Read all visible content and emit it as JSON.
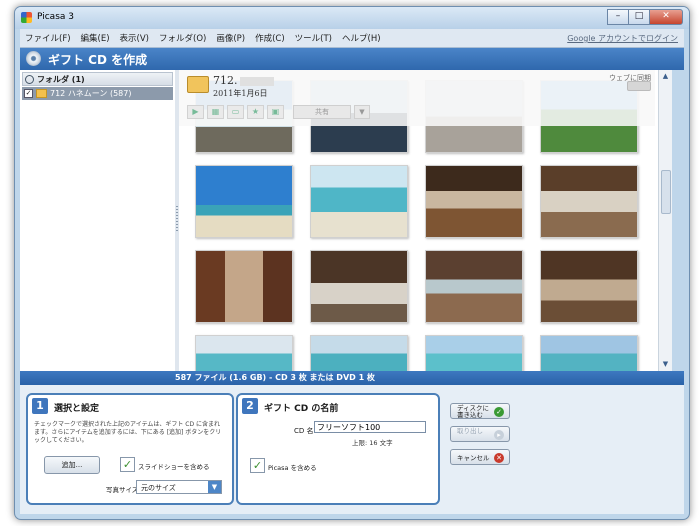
{
  "window": {
    "title": "Picasa 3"
  },
  "menu": {
    "items": [
      "ファイル(F)",
      "編集(E)",
      "表示(V)",
      "フォルダ(O)",
      "画像(P)",
      "作成(C)",
      "ツール(T)",
      "ヘルプ(H)"
    ],
    "google_account_link": "Google アカウントでログイン"
  },
  "ribbon": {
    "title": "ギフト CD を作成"
  },
  "sidebar": {
    "header": "フォルダ (1)",
    "folder": {
      "label": "712 ハネムーン (587)",
      "checked": true
    }
  },
  "album": {
    "name": "712.",
    "date": "2011年1月6日",
    "web_sync_label": "ウェブに同期",
    "share_label": "共有",
    "photo_count": 16
  },
  "status": {
    "text": "587 ファイル (1.6 GB) - CD 3 枚 または DVD 1 枚"
  },
  "step1": {
    "number": "1",
    "title": "選択と設定",
    "description": "チェックマークで選択された上記のアイテムは、ギフト CD に含まれます。さらにアイテムを追加するには、下にある [追加] ボタンをクリックしてください。",
    "add_button": "追加...",
    "slideshow_label": "スライドショーを含める",
    "slideshow_checked": true,
    "photo_size_label": "写真サイズ",
    "photo_size_value": "元のサイズ"
  },
  "step2": {
    "number": "2",
    "title": "ギフト CD の名前",
    "cd_name_label": "CD 名",
    "cd_name_value": "フリーソフト100",
    "limit_text": "上限: 16 文字",
    "include_picasa_label": "Picasa を含める",
    "include_picasa_checked": true
  },
  "actions": {
    "burn_label": "ディスクに書き込む",
    "export_label": "取り出し",
    "cancel_label": "キャンセル"
  },
  "colors": {
    "ribbon_blue": "#2f68ad",
    "panel_border": "#4b7fb8",
    "status_bar": "#2a62a8"
  }
}
